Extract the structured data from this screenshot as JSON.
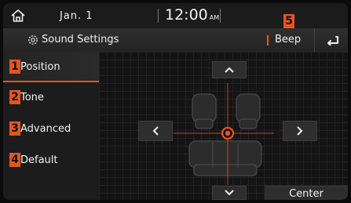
{
  "status_bar": {
    "date": "Jan.  1",
    "time": "12:00",
    "ampm": "AM"
  },
  "header": {
    "title": "Sound Settings",
    "beep_label": "Beep"
  },
  "sidebar": {
    "items": [
      {
        "label": "Position",
        "badge": "1",
        "active": true
      },
      {
        "label": "Tone",
        "badge": "2",
        "active": false
      },
      {
        "label": "Advanced",
        "badge": "3",
        "active": false
      },
      {
        "label": "Default",
        "badge": "4",
        "active": false
      }
    ]
  },
  "callouts": {
    "beep_badge": "5"
  },
  "position_panel": {
    "center_label": "Center"
  },
  "colors": {
    "accent": "#e8541d",
    "background": "#161616"
  },
  "icons": [
    "home-icon",
    "gear-icon",
    "back-arrow-icon",
    "chevron-up-icon",
    "chevron-down-icon",
    "chevron-left-icon",
    "chevron-right-icon",
    "balance-point-icon"
  ]
}
